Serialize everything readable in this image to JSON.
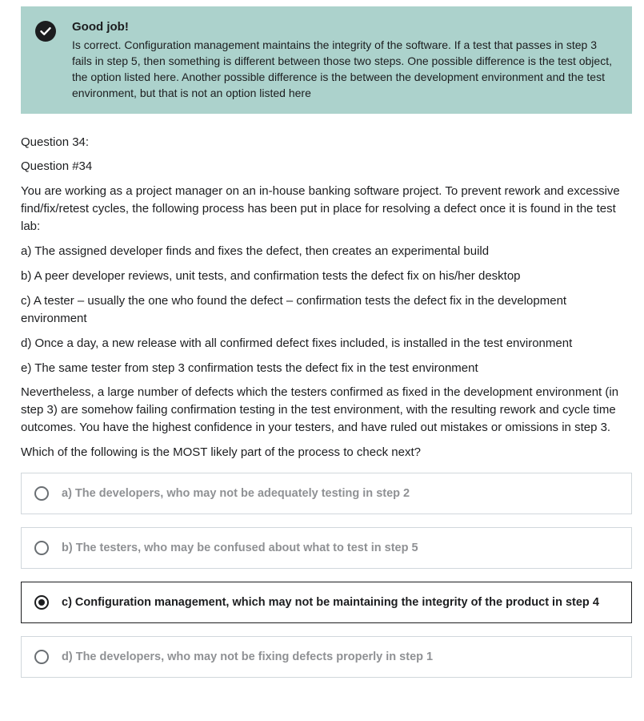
{
  "feedback": {
    "title": "Good job!",
    "text": "Is correct. Configuration management maintains the integrity of the software. If a test that passes in step 3 fails in step 5, then something is different between those two steps. One possible difference is the test object, the option listed here. Another possible difference is the between the development environment and the test environment, but that is not an option listed here",
    "icon": "checkmark-icon",
    "bg_color": "#acd2cc"
  },
  "question": {
    "label": "Question 34:",
    "number": "Question #34",
    "body": "You are working as a project manager on an in-house banking software project. To prevent rework and excessive find/fix/retest cycles, the following process has been put in place for resolving a defect once it is found in the test lab:",
    "steps": [
      "a) The assigned developer finds and fixes the defect, then creates an experimental build",
      "b) A peer developer reviews, unit tests, and confirmation tests the defect fix on his/her desktop",
      "c) A tester – usually the one who found the defect – confirmation tests the defect fix in the development environment",
      "d) Once a day, a new release with all confirmed defect fixes included, is installed in the test environment",
      "e) The same tester from step 3 confirmation tests the defect fix in the test environment"
    ],
    "nevertheless": "Nevertheless, a large number of defects which the testers confirmed as fixed in the development environment (in step 3) are somehow failing confirmation testing in the test environment, with the resulting rework and cycle time outcomes. You have the highest confidence in your testers, and have ruled out mistakes or omissions in step 3.",
    "prompt": "Which of the following is the MOST likely part of the process to check next?"
  },
  "options": [
    {
      "label": "a) The developers, who may not be adequately testing in step 2",
      "selected": false
    },
    {
      "label": "b) The testers, who may be confused about what to test in step 5",
      "selected": false
    },
    {
      "label": "c) Configuration management, which may not be maintaining the integrity of the product in step 4",
      "selected": true
    },
    {
      "label": "d) The developers, who may not be fixing defects properly in step 1",
      "selected": false
    }
  ]
}
